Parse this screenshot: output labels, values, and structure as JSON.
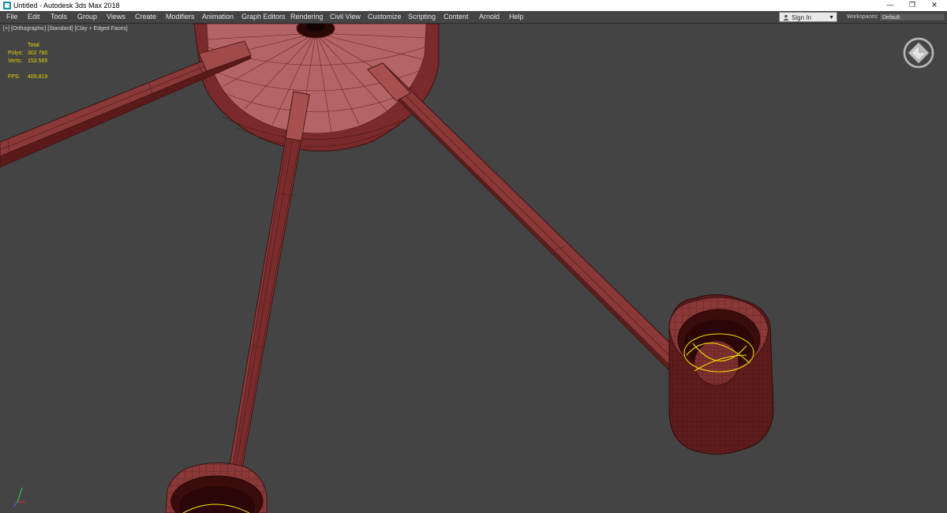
{
  "window": {
    "title": "Untitled - Autodesk 3ds Max 2018",
    "minimize_glyph": "—",
    "restore_glyph": "❐",
    "close_glyph": "✕"
  },
  "menu": {
    "items": [
      "File",
      "Edit",
      "Tools",
      "Group",
      "Views",
      "Create",
      "Modifiers",
      "Animation",
      "Graph Editors",
      "Rendering",
      "Civil View",
      "Customize",
      "Scripting",
      "Content",
      "Arnold",
      "Help"
    ]
  },
  "account": {
    "sign_in_label": "Sign In",
    "workspaces_label": "Workspaces:",
    "workspace_value": "Default"
  },
  "viewport": {
    "label_plus": "[+]",
    "label_view": "[Orthographic]",
    "label_shading": "[Standard]",
    "label_mode": "[Clay + Edged Faces]"
  },
  "stats": {
    "header": "Total",
    "polys_label": "Polys:",
    "polys_value": "302 760",
    "verts_label": "Verts:",
    "verts_value": "153 565",
    "fps_label": "FPS:",
    "fps_value": "409,819"
  },
  "colors": {
    "viewport_bg": "#444444",
    "clay": "#8a3a3a",
    "stats_yellow": "#e6d600",
    "selection_yellow": "#f2e200"
  },
  "icons": {
    "viewcube": "viewcube-icon",
    "axis": "axis-tripod-icon",
    "user": "user-icon"
  }
}
